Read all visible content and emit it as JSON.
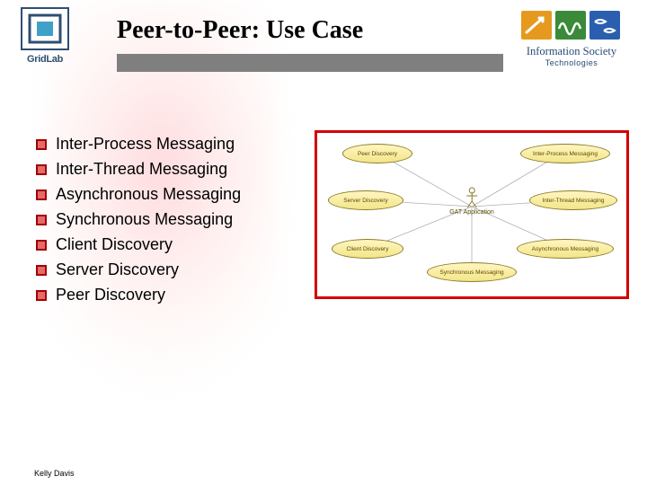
{
  "title": "Peer-to-Peer: Use Case",
  "logo_left_label": "GridLab",
  "logo_right_line1": "Information Society",
  "logo_right_line2": "Technologies",
  "bullets": [
    "Inter-Process Messaging",
    "Inter-Thread Messaging",
    "Asynchronous Messaging",
    "Synchronous Messaging",
    "Client Discovery",
    "Server Discovery",
    "Peer Discovery"
  ],
  "diagram": {
    "actor_label": "GAT Application",
    "usecases": {
      "tl": "Peer Discovery",
      "tr": "Inter-Process Messaging",
      "ml": "Server Discovery",
      "mr": "Inter-Thread Messaging",
      "bl": "Client Discovery",
      "br": "Asynchronous Messaging",
      "bc": "Synchronous Messaging"
    }
  },
  "footer": "Kelly Davis"
}
